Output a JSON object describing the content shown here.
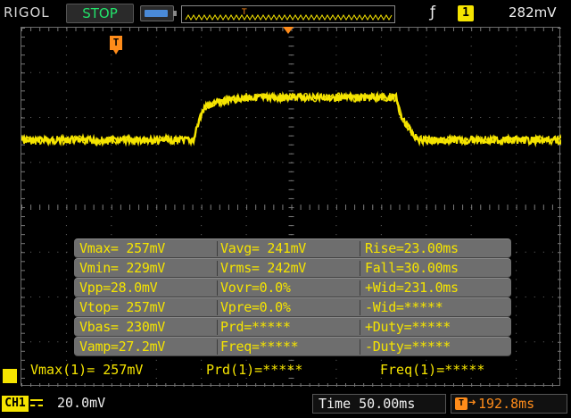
{
  "header": {
    "brand": "RIGOL",
    "run_status": "STOP",
    "trigger": {
      "edge_icon": "rising-edge-icon",
      "source": "1",
      "level": "282mV"
    }
  },
  "markers": {
    "channel_marker": "1",
    "trigger_marker": "T",
    "trigger_position_marker": "T"
  },
  "measurements": {
    "rows": [
      [
        "Vmax= 257mV",
        "Vavg= 241mV",
        "Rise=23.00ms"
      ],
      [
        "Vmin= 229mV",
        "Vrms= 242mV",
        "Fall=30.00ms"
      ],
      [
        "Vpp=28.0mV",
        "Vovr=0.0%",
        "+Wid=231.0ms"
      ],
      [
        "Vtop= 257mV",
        "Vpre=0.0%",
        "-Wid=*****"
      ],
      [
        "Vbas= 230mV",
        "Prd=*****",
        "+Duty=*****"
      ],
      [
        "Vamp=27.2mV",
        "Freq=*****",
        "-Duty=*****"
      ]
    ]
  },
  "readouts": {
    "vmax": "Vmax(1)= 257mV",
    "prd": "Prd(1)=*****",
    "freq": "Freq(1)=*****"
  },
  "footer": {
    "channel": "CH1",
    "coupling_icon": "dc-coupling-icon",
    "scale": "20.0mV",
    "timebase": "Time 50.00ms",
    "trigger_offset_label": "T",
    "trigger_offset": "192.8ms"
  },
  "colors": {
    "channel1": "#f5e400",
    "trigger": "#ff8c1a",
    "status_stop": "#22e26a",
    "grid": "#5a5a5a"
  }
}
